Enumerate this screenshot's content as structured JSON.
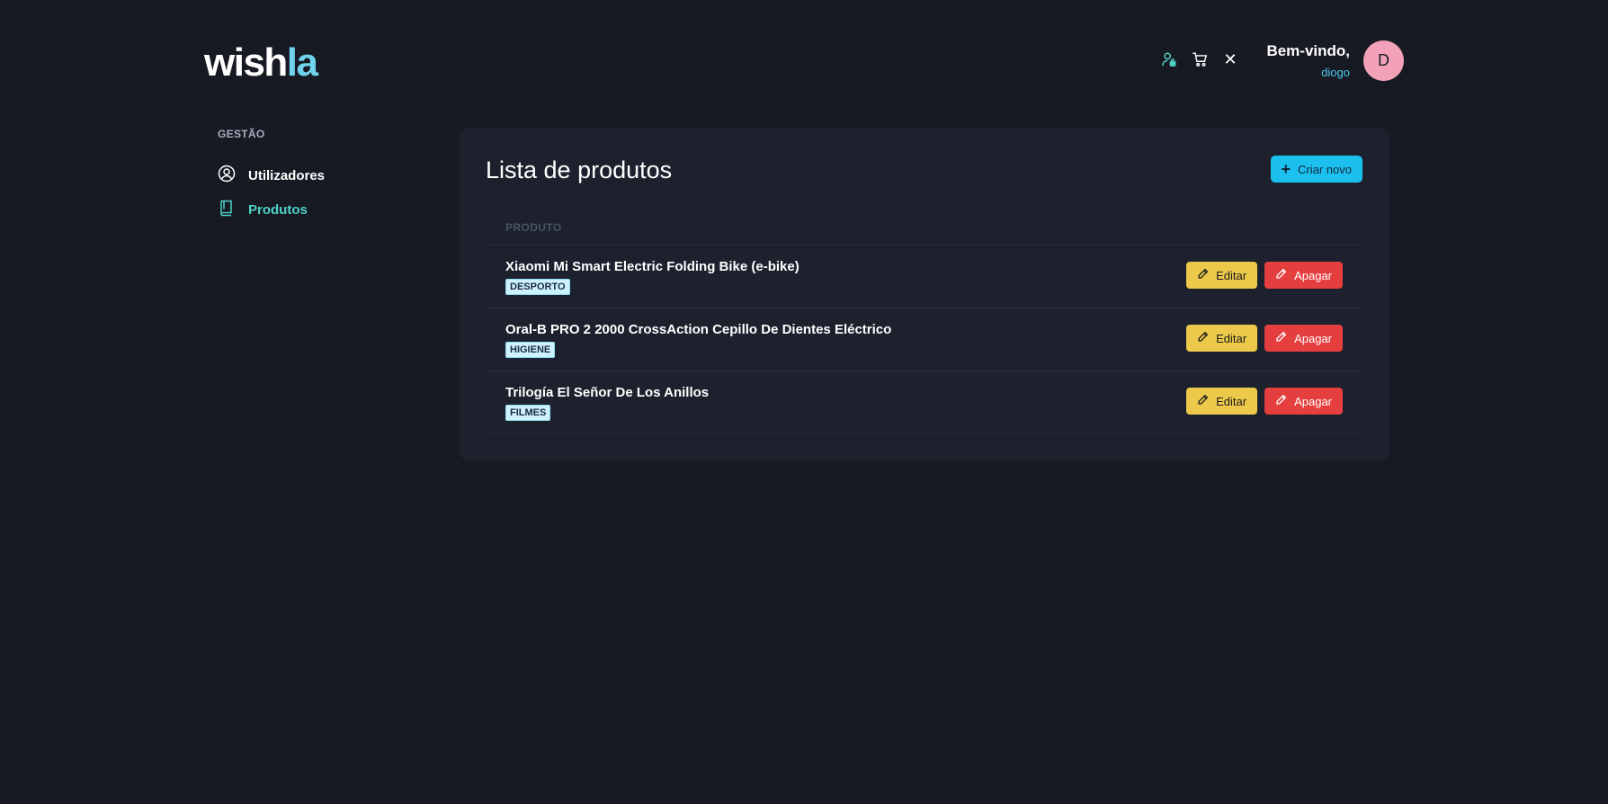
{
  "logo": {
    "part1": "wish",
    "part2": "la"
  },
  "header": {
    "welcome": "Bem-vindo,",
    "username": "diogo",
    "avatar_initial": "D",
    "icons": [
      "user-lock-icon",
      "cart-icon",
      "close-icon"
    ],
    "close_glyph": "✕"
  },
  "sidebar": {
    "section_title": "GESTÃO",
    "items": [
      {
        "label": "Utilizadores",
        "icon": "user-circle-icon",
        "active": false
      },
      {
        "label": "Produtos",
        "icon": "book-icon",
        "active": true
      }
    ]
  },
  "main": {
    "title": "Lista de produtos",
    "create_label": "Criar novo",
    "column_header": "PRODUTO",
    "edit_label": "Editar",
    "delete_label": "Apagar",
    "products": [
      {
        "name": "Xiaomi Mi Smart Electric Folding Bike (e-bike)",
        "category": "DESPORTO"
      },
      {
        "name": "Oral-B PRO 2 2000 CrossAction Cepillo De Dientes Eléctrico",
        "category": "HIGIENE"
      },
      {
        "name": "Trilogía El Señor De Los Anillos",
        "category": "FILMES"
      }
    ]
  },
  "colors": {
    "background": "#171a23",
    "card": "#1c212d",
    "accent": "#1cc0ee",
    "active_nav": "#4fd1c5",
    "edit": "#ecc94b",
    "delete": "#e53e3e",
    "avatar": "#f2a1b8"
  }
}
